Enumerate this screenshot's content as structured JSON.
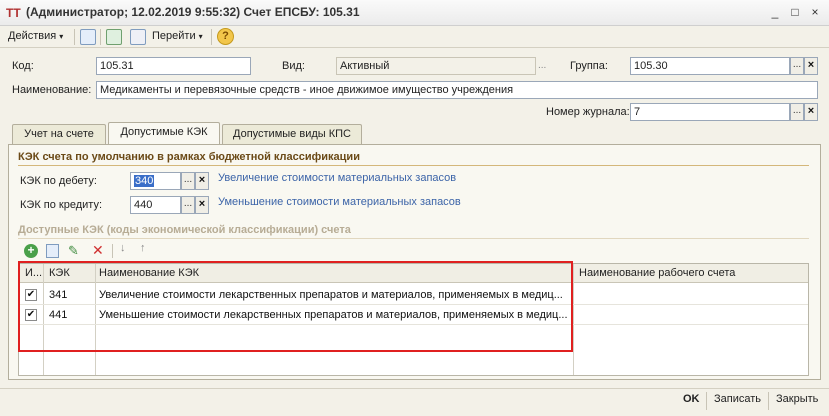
{
  "window": {
    "title": "(Администратор; 12.02.2019 9:55:32) Счет ЕПСБУ: 105.31",
    "icon_label": "ТТ",
    "controls": [
      "_",
      "□",
      "×"
    ]
  },
  "toolbar": {
    "actions_label": "Действия",
    "goto_label": "Перейти",
    "help_label": "?"
  },
  "form": {
    "code_label": "Код:",
    "code_value": "105.31",
    "type_label": "Вид:",
    "type_value": "Активный",
    "group_label": "Группа:",
    "group_value": "105.30",
    "name_label": "Наименование:",
    "name_value": "Медикаменты и перевязочные средств - иное движимое имущество учреждения",
    "journal_label": "Номер журнала:",
    "journal_value": "7",
    "pick": "...",
    "clear": "×"
  },
  "tabs": [
    {
      "label": "Учет на счете"
    },
    {
      "label": "Допустимые КЭК"
    },
    {
      "label": "Допустимые виды КПС"
    }
  ],
  "panel": {
    "default_section_title": "КЭК счета по умолчанию в рамках бюджетной классификации",
    "debit_label": "КЭК по дебету:",
    "debit_value": "340",
    "debit_desc": "Увеличение стоимости материальных запасов",
    "credit_label": "КЭК по кредиту:",
    "credit_value": "440",
    "credit_desc": "Уменьшение стоимости материальных запасов",
    "available_section_title": "Доступные КЭК (коды экономической классификации) счета"
  },
  "table": {
    "columns": {
      "flag": "И...",
      "kek": "КЭК",
      "name": "Наименование КЭК",
      "account_name": "Наименование рабочего счета"
    },
    "rows": [
      {
        "checked": "✔",
        "kek": "341",
        "name": "Увеличение стоимости лекарственных препаратов и материалов, применяемых в медиц...",
        "account_name": ""
      },
      {
        "checked": "✔",
        "kek": "441",
        "name": "Уменьшение стоимости лекарственных препаратов и материалов, применяемых в медиц...",
        "account_name": ""
      }
    ]
  },
  "footer": {
    "ok_label": "OK",
    "save_label": "Записать",
    "close_label": "Закрыть"
  },
  "colors": {
    "highlight": "#e02020",
    "link": "#3c64a8",
    "section_title": "#6b4a17"
  }
}
